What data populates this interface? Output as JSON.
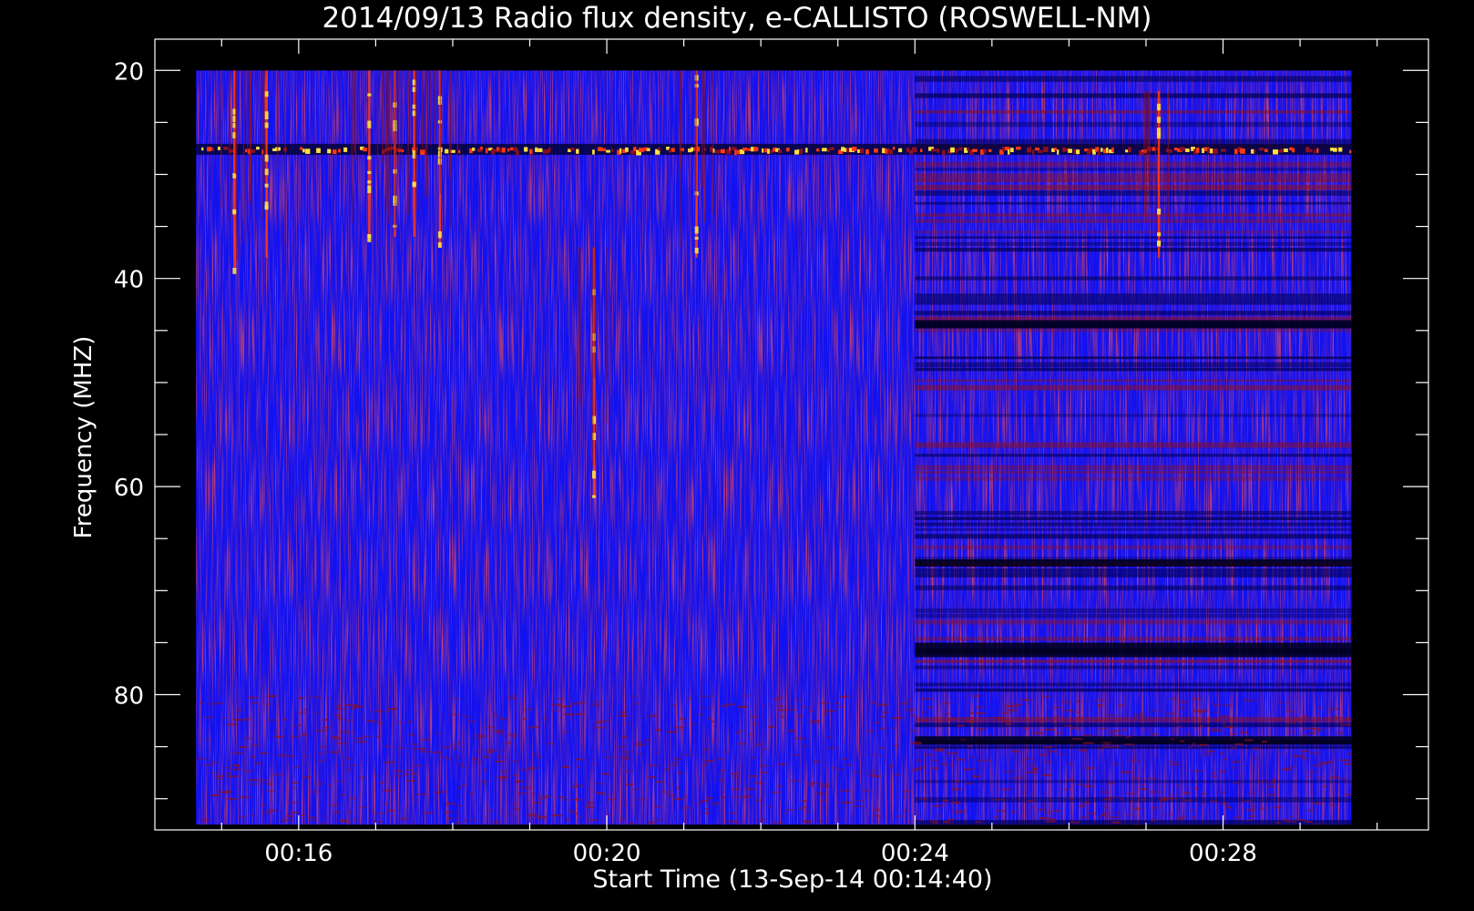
{
  "chart_data": {
    "type": "heatmap",
    "title": "2014/09/13  Radio flux density, e-CALLISTO (ROSWELL-NM)",
    "xlabel": "Start Time (13-Sep-14 00:14:40)",
    "ylabel": "Frequency (MHZ)",
    "x_axis": {
      "unit": "time",
      "range": [
        "00:14:08",
        "00:30:40"
      ],
      "data_range": [
        "00:14:40",
        "00:29:40"
      ],
      "major_ticks": [
        "00:16",
        "00:20",
        "00:24",
        "00:28"
      ],
      "minor_tick_interval_seconds": 60
    },
    "y_axis": {
      "unit": "MHz",
      "range": [
        17,
        93
      ],
      "data_range": [
        20,
        92.5
      ],
      "inverted": true,
      "major_ticks": [
        20,
        40,
        60,
        80
      ],
      "minor_tick_interval": 5
    },
    "colormap": {
      "background": "#1212f0",
      "low": "#000050",
      "mid": "#8a1020",
      "high": "#ff3a10",
      "peak": "#ffe040"
    },
    "features": [
      {
        "type": "persistent_band",
        "freq_mhz": 27.5
      },
      {
        "type": "burst",
        "time": "00:15:10",
        "freq_range": [
          20,
          39
        ]
      },
      {
        "type": "burst",
        "time": "00:15:35",
        "freq_range": [
          20,
          38
        ]
      },
      {
        "type": "burst",
        "time": "00:16:55",
        "freq_range": [
          20,
          36
        ]
      },
      {
        "type": "burst",
        "time": "00:17:15",
        "freq_range": [
          20,
          36
        ]
      },
      {
        "type": "burst",
        "time": "00:17:30",
        "freq_range": [
          20,
          36
        ]
      },
      {
        "type": "burst",
        "time": "00:17:50",
        "freq_range": [
          20,
          37
        ]
      },
      {
        "type": "burst",
        "time": "00:19:50",
        "freq_range": [
          37,
          61
        ]
      },
      {
        "type": "burst",
        "time": "00:21:10",
        "freq_range": [
          20,
          38
        ]
      },
      {
        "type": "burst",
        "time": "00:27:10",
        "freq_range": [
          22,
          38
        ]
      }
    ],
    "grid": false,
    "legend": "none"
  }
}
